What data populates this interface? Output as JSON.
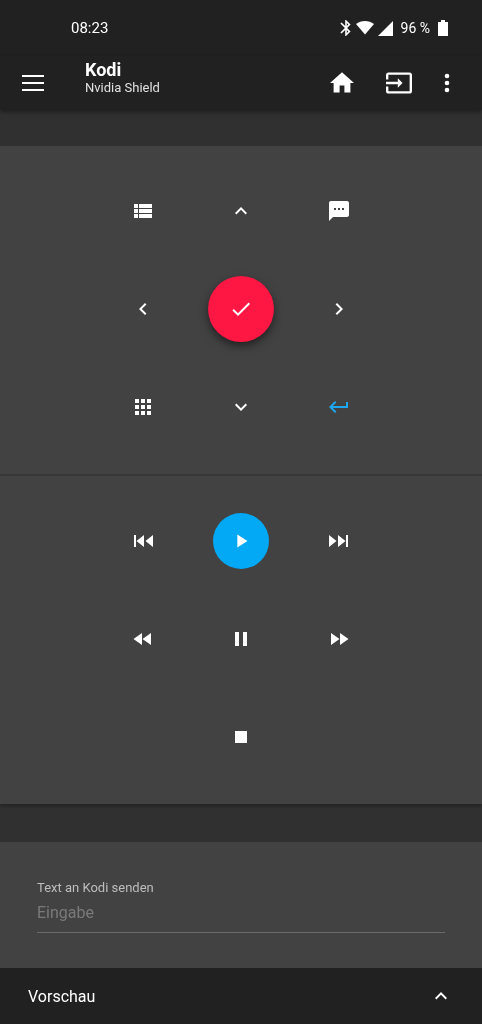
{
  "status_bar": {
    "time": "08:23",
    "battery": "96 %"
  },
  "app_bar": {
    "title": "Kodi",
    "subtitle": "Nvidia Shield"
  },
  "navigation_pad": [
    {
      "kind": "list"
    },
    {
      "kind": "up"
    },
    {
      "kind": "chat"
    },
    {
      "kind": "left"
    },
    {
      "kind": "select"
    },
    {
      "kind": "right"
    },
    {
      "kind": "grid"
    },
    {
      "kind": "down"
    },
    {
      "kind": "enter"
    }
  ],
  "media_controls": [
    {
      "kind": "previous"
    },
    {
      "kind": "play"
    },
    {
      "kind": "next"
    },
    {
      "kind": "rewind"
    },
    {
      "kind": "pause"
    },
    {
      "kind": "forward"
    },
    {
      "kind": "empty"
    },
    {
      "kind": "stop"
    },
    {
      "kind": "empty"
    }
  ],
  "text_input": {
    "label": "Text an Kodi senden",
    "placeholder": "Eingabe"
  },
  "bottom_bar": {
    "label": "Vorschau"
  }
}
